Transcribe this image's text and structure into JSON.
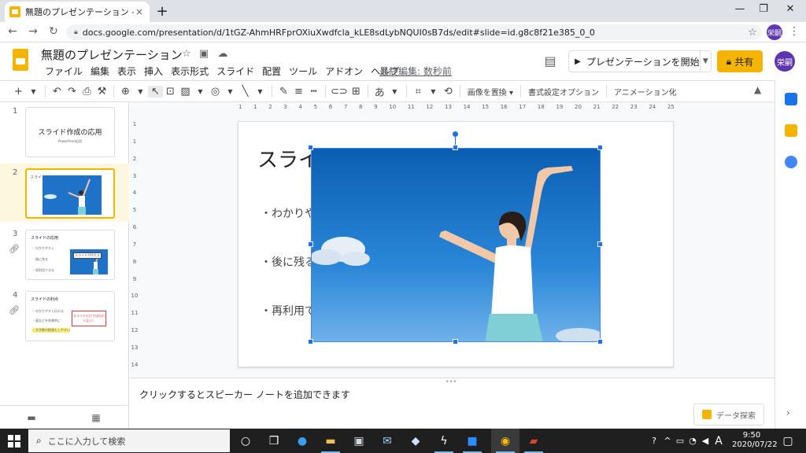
{
  "browser": {
    "tab_title": "無題のプレゼンテーション - Google ス",
    "tab_close": "×",
    "new_tab": "+",
    "win_min": "—",
    "win_restore": "❐",
    "win_close": "✕",
    "url": "docs.google.com/presentation/d/1tGZ-AhmHRFprOXiuXwdfcla_kLE8sdLybNQUI0sB7ds/edit#slide=id.g8c8f21e385_0_0",
    "avatar": "栄嗣",
    "back": "←",
    "forward": "→",
    "reload": "↻",
    "bookmark_star": "☆",
    "menu": "⋮"
  },
  "app": {
    "doc_title": "無題のプレゼンテーション",
    "menus": [
      "ファイル",
      "編集",
      "表示",
      "挿入",
      "表示形式",
      "スライド",
      "配置",
      "ツール",
      "アドオン",
      "ヘルプ"
    ],
    "last_edit": "最終編集: 数秒前",
    "present_label": "プレゼンテーションを開始",
    "share_label": "共有",
    "user_avatar": "栄嗣",
    "colors": {
      "accent": "#f4b400",
      "selection": "#1a73e8",
      "avatar": "#5e35b1"
    }
  },
  "toolbar": {
    "replace_image": "画像を置換 ▾",
    "format_options": "書式設定オプション",
    "animation": "アニメーション化",
    "font_glyph": "あ"
  },
  "filmstrip": {
    "slides": [
      {
        "num": "1",
        "title": "スライド作成の応用",
        "sub": "PowerPoint応用"
      },
      {
        "num": "2",
        "title": "スライド"
      },
      {
        "num": "3",
        "title": "スライドの応用",
        "lines": [
          "・わかりやすく",
          "・後に残る",
          "・再利用できる"
        ],
        "box": "スライドが作れる"
      },
      {
        "num": "4",
        "title": "スライドの利点",
        "lines": [
          "・わかりやすく伝わる",
          "・図などを効果的に",
          "・文字数の削減もしやすい"
        ],
        "box": "スライドだけでは伝わらない！"
      }
    ]
  },
  "slide": {
    "heading": "スライ",
    "bullets": [
      "・わかりや",
      "・後に残る",
      "・再利用で"
    ]
  },
  "ruler": {
    "h": [
      "1",
      "1",
      "2",
      "3",
      "4",
      "5",
      "6",
      "7",
      "8",
      "9",
      "10",
      "11",
      "12",
      "13",
      "14",
      "15",
      "16",
      "17",
      "18",
      "19",
      "20",
      "21",
      "22",
      "23",
      "24",
      "25"
    ],
    "v": [
      "1",
      "1",
      "2",
      "3",
      "4",
      "5",
      "6",
      "7",
      "8",
      "9",
      "10",
      "11",
      "12",
      "13",
      "14"
    ]
  },
  "notes": {
    "placeholder": "クリックするとスピーカー ノートを追加できます",
    "explore": "データ探索"
  },
  "taskbar": {
    "search_placeholder": "ここに入力して検索",
    "ime": "A",
    "time": "9:50",
    "date": "2020/07/22"
  }
}
